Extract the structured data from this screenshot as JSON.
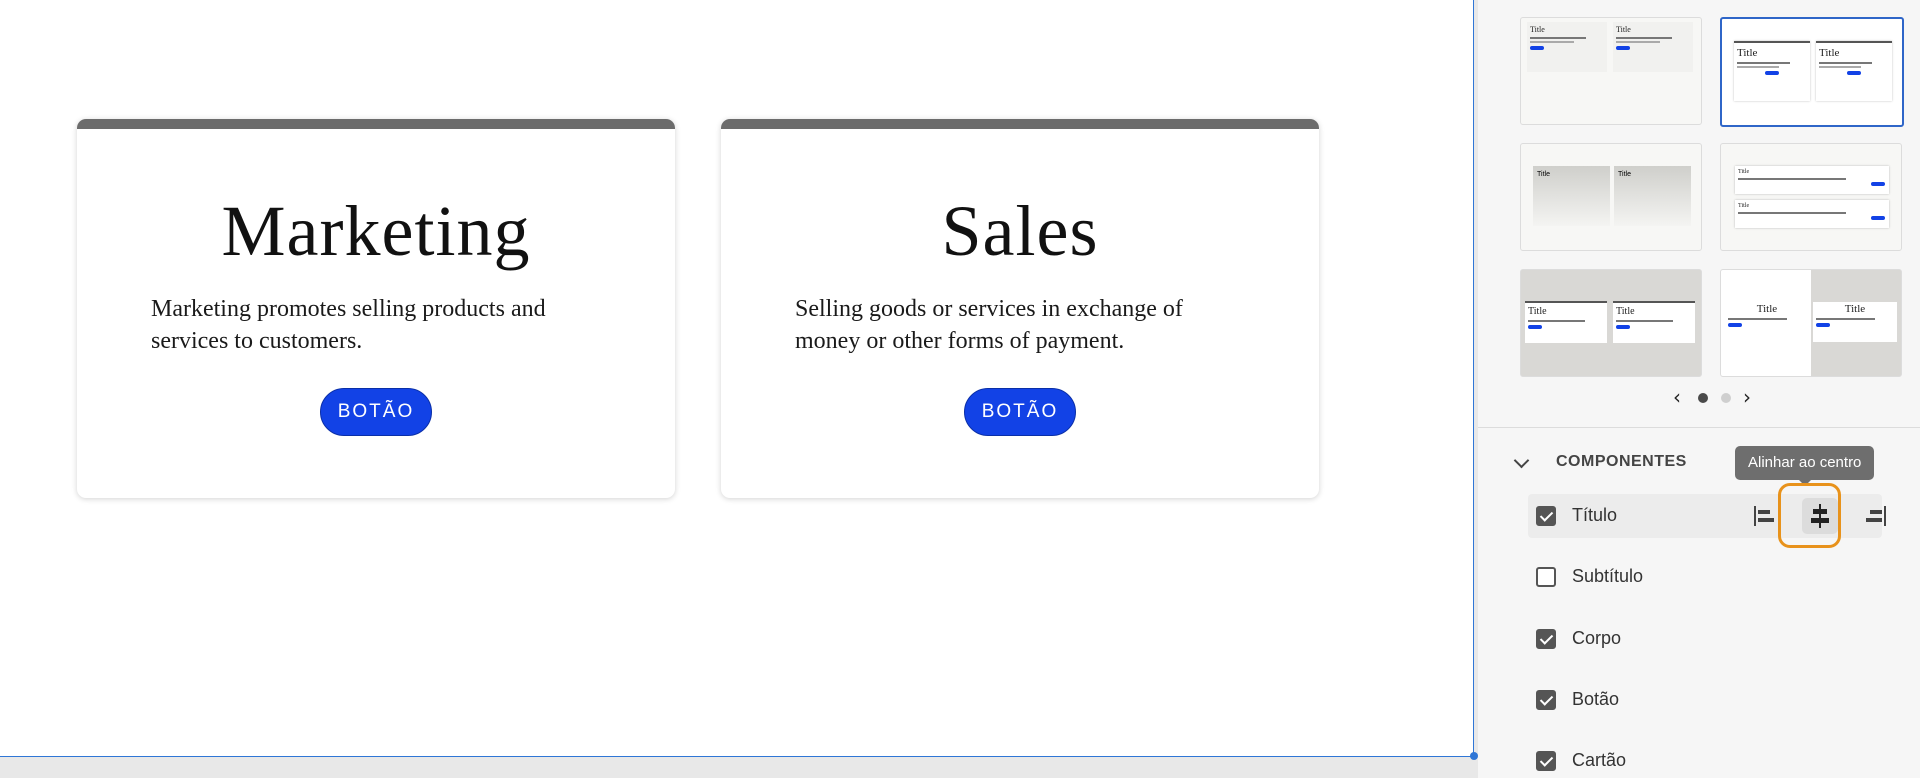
{
  "canvas": {
    "cards": [
      {
        "title": "Marketing",
        "body": "Marketing promotes selling products and services to customers.",
        "button": "BOTÃO"
      },
      {
        "title": "Sales",
        "body": "Selling goods or services in exchange of money or other forms of payment.",
        "button": "BOTÃO"
      }
    ]
  },
  "panel": {
    "layouts": {
      "thumb_title": "Title",
      "thumb_subtitle": "At vero eos et accusamus et iusto.",
      "pager_current": 1,
      "pager_total": 2,
      "pager_prev_icon": "chevron-left-icon",
      "pager_next_icon": "chevron-right-icon"
    },
    "components": {
      "section_title": "COMPONENTES",
      "tooltip": "Alinhar ao centro",
      "items": [
        {
          "label": "Título",
          "checked": true
        },
        {
          "label": "Subtítulo",
          "checked": false
        },
        {
          "label": "Corpo",
          "checked": true
        },
        {
          "label": "Botão",
          "checked": true
        },
        {
          "label": "Cartão",
          "checked": true
        }
      ],
      "align_buttons": [
        "align-left-icon",
        "align-center-icon",
        "align-right-icon"
      ],
      "active_align": "align-center-icon"
    }
  },
  "colors": {
    "accent": "#1242e6",
    "selection": "#2f76d6",
    "focus_ring": "#e8921b"
  }
}
